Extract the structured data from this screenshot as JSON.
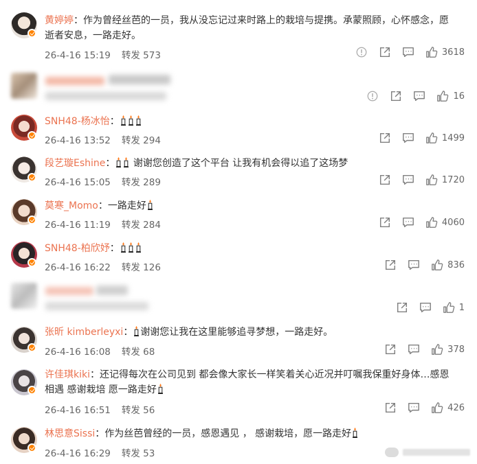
{
  "comments": [
    {
      "user": "黄婷婷",
      "text": "作为曾经丝芭的一员，我从没忘记过来时路上的栽培与提携。承蒙照顾，心怀感念，愿",
      "text2": "逝者安息，一路走好。",
      "time": "26-4-16 15:19",
      "repost": "转发 573",
      "likes": "3618"
    },
    {
      "user": "",
      "text": "",
      "time": "",
      "repost": "",
      "likes": "16"
    },
    {
      "user": "SNH48-杨冰怡",
      "text": "",
      "time": "26-4-16 13:52",
      "repost": "转发 294",
      "likes": "1499"
    },
    {
      "user": "段艺璇Eshine",
      "text": "谢谢您创造了这个平台 让我有机会得以追了这场梦",
      "time": "26-4-16 15:05",
      "repost": "转发 289",
      "likes": "1720"
    },
    {
      "user": "莫寒_Momo",
      "text": "一路走好",
      "time": "26-4-16 11:19",
      "repost": "转发 284",
      "likes": "4060"
    },
    {
      "user": "SNH48-柏欣妤",
      "text": "",
      "time": "26-4-16 16:22",
      "repost": "转发 126",
      "likes": "836"
    },
    {
      "user": "",
      "text": "",
      "time": "",
      "repost": "",
      "likes": "1"
    },
    {
      "user": "张昕 kimberleyxi",
      "text": "谢谢您让我在这里能够追寻梦想，一路走好。",
      "time": "26-4-16 16:08",
      "repost": "转发 68",
      "likes": "378"
    },
    {
      "user": "许佳琪kiki",
      "text": "还记得每次在公司见到 都会像大家长一样笑着关心近况并叮嘱我保重好身体…感恩",
      "text2": "相遇 感谢栽培 愿一路走好",
      "time": "26-4-16 16:51",
      "repost": "转发 56",
      "likes": "426"
    },
    {
      "user": "林思意Sissi",
      "text": "作为丝芭曾经的一员，感恩遇见 ， 感谢栽培，愿一路走好",
      "time": "26-4-16 16:29",
      "repost": "转发 53",
      "likes": ""
    }
  ],
  "separator": "：",
  "colors": {
    "username": "#eb7350",
    "verified": "#ff8200",
    "icon": "#808080"
  }
}
